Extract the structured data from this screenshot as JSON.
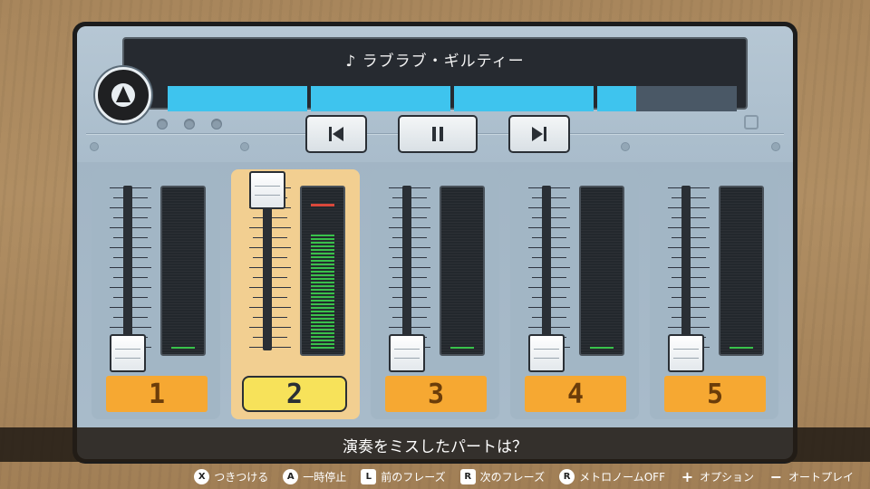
{
  "song": {
    "title": "♪ ラブラブ・ギルティー",
    "progress": 0.82
  },
  "transport": {
    "prev_icon": "skip-previous-icon",
    "pause_icon": "pause-icon",
    "next_icon": "skip-next-icon"
  },
  "channels": [
    {
      "number": "1",
      "active": false,
      "fader_level": 0.0,
      "meter_level": 0.0
    },
    {
      "number": "2",
      "active": true,
      "fader_level": 1.0,
      "meter_level": 0.72
    },
    {
      "number": "3",
      "active": false,
      "fader_level": 0.0,
      "meter_level": 0.0
    },
    {
      "number": "4",
      "active": false,
      "fader_level": 0.0,
      "meter_level": 0.0
    },
    {
      "number": "5",
      "active": false,
      "fader_level": 0.0,
      "meter_level": 0.0
    }
  ],
  "question": "演奏をミスしたパートは？",
  "controls": [
    {
      "glyph": "X",
      "label": "つきつける",
      "icon": "x-button-icon"
    },
    {
      "glyph": "A",
      "label": "一時停止",
      "icon": "a-button-icon"
    },
    {
      "glyph": "L",
      "label": "前のフレーズ",
      "icon": "l-button-icon"
    },
    {
      "glyph": "R",
      "label": "次のフレーズ",
      "icon": "r-button-icon"
    },
    {
      "glyph": "R",
      "label": "メトロノームOFF",
      "icon": "r-stick-icon"
    },
    {
      "glyph": "+",
      "label": "オプション",
      "icon": "plus-button-icon"
    },
    {
      "glyph": "−",
      "label": "オートプレイ",
      "icon": "minus-button-icon"
    }
  ],
  "colors": {
    "progress": "#3ec4ee",
    "channel_number": "#f6a832",
    "channel_number_active": "#f7e25a",
    "channel_active_bg": "#f2cf91",
    "meter_green": "#39c24a",
    "meter_peak": "#d9483b"
  }
}
